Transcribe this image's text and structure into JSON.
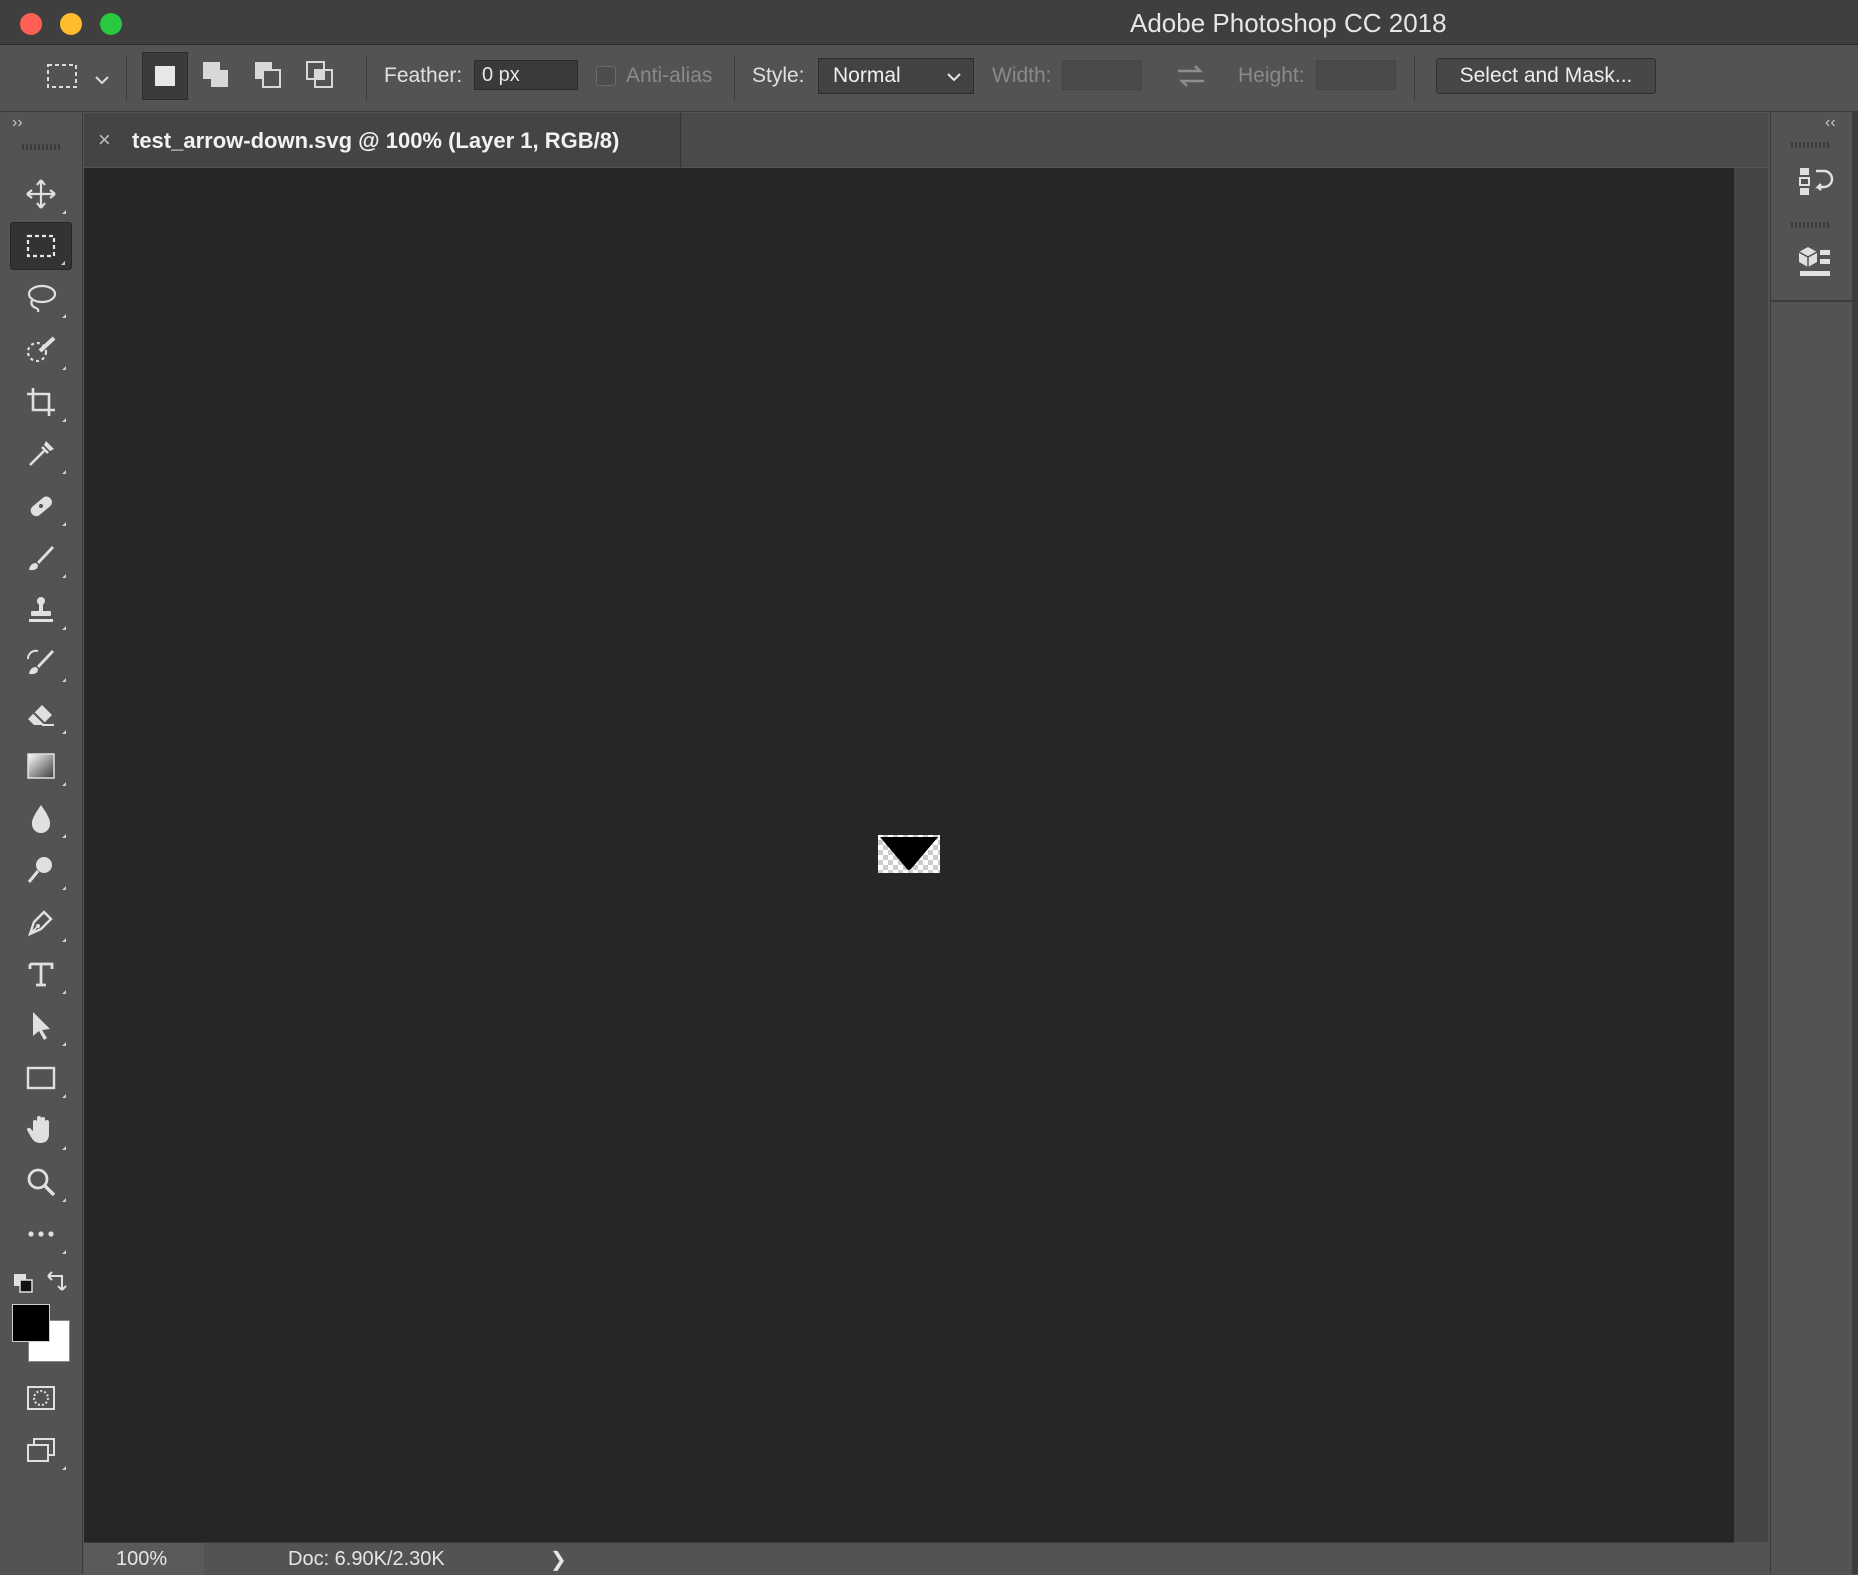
{
  "window": {
    "title": "Adobe Photoshop CC 2018"
  },
  "options_bar": {
    "feather_label": "Feather:",
    "feather_value": "0 px",
    "antialias_label": "Anti-alias",
    "style_label": "Style:",
    "style_value": "Normal",
    "width_label": "Width:",
    "width_value": "",
    "height_label": "Height:",
    "height_value": "",
    "select_mask_label": "Select and Mask..."
  },
  "document": {
    "tab_label": "test_arrow-down.svg @ 100% (Layer 1, RGB/8)",
    "close_glyph": "×"
  },
  "status_bar": {
    "zoom": "100%",
    "doc_info": "Doc: 6.90K/2.30K",
    "arrow_glyph": "❯"
  },
  "toolbox": {
    "collapse_glyph": "››",
    "tools": [
      "move-tool",
      "rectangular-marquee-tool",
      "lasso-tool",
      "quick-selection-tool",
      "crop-tool",
      "eyedropper-tool",
      "spot-healing-tool",
      "brush-tool",
      "clone-stamp-tool",
      "history-brush-tool",
      "eraser-tool",
      "gradient-tool",
      "blur-tool",
      "dodge-tool",
      "pen-tool",
      "type-tool",
      "path-selection-tool",
      "rectangle-tool",
      "hand-tool",
      "zoom-tool",
      "edit-toolbar"
    ],
    "foreground_color": "#000000",
    "background_color": "#ffffff"
  },
  "right_dock": {
    "collapse_glyph": "‹‹"
  }
}
